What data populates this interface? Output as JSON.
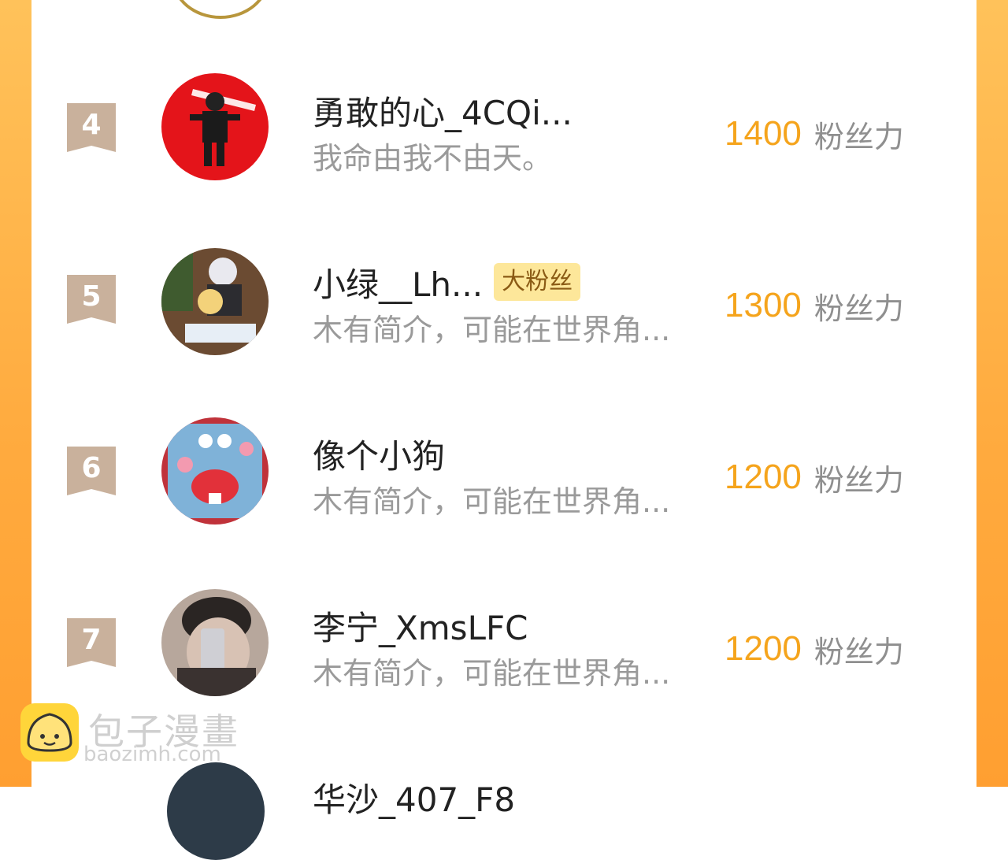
{
  "score_unit": "粉丝力",
  "rows": [
    {
      "rank": "4",
      "name": "勇敢的心_4CQi...",
      "badge": "",
      "bio": "我命由我不由天。",
      "score": "1400"
    },
    {
      "rank": "5",
      "name": "小绿__Lh...",
      "badge": "大粉丝",
      "bio": "木有简介，可能在世界角...",
      "score": "1300"
    },
    {
      "rank": "6",
      "name": "像个小狗",
      "badge": "",
      "bio": "木有简介，可能在世界角...",
      "score": "1200"
    },
    {
      "rank": "7",
      "name": "李宁_XmsLFC",
      "badge": "",
      "bio": "木有简介，可能在世界角...",
      "score": "1200"
    }
  ],
  "partial_row": {
    "name": "华沙_407_F8"
  },
  "watermark": {
    "brand_cn": "包子漫畫",
    "brand_en": "baozimh.com"
  },
  "colors": {
    "accent": "#f5a41c",
    "side_gradient": "#ffab3f",
    "badge_bg": "#fde79a",
    "rank_bg": "#c9b19c"
  }
}
